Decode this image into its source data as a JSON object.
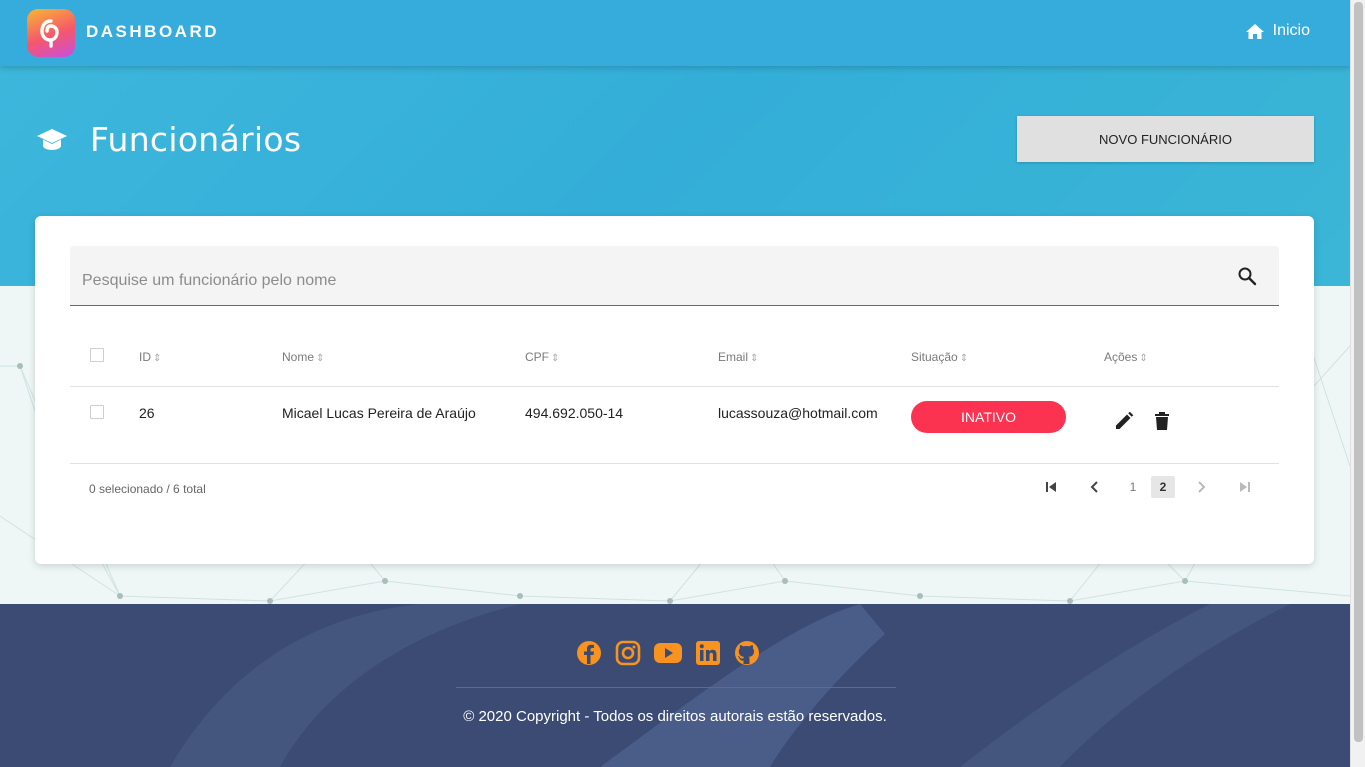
{
  "header": {
    "brand": "DASHBOARD",
    "home_label": "Inicio"
  },
  "page": {
    "title": "Funcionários",
    "new_button": "NOVO FUNCIONÁRIO"
  },
  "search": {
    "placeholder": "Pesquise um funcionário pelo nome",
    "value": ""
  },
  "table": {
    "columns": [
      "ID",
      "Nome",
      "CPF",
      "Email",
      "Situação",
      "Ações"
    ],
    "rows": [
      {
        "id": "26",
        "nome": "Micael Lucas Pereira de Araújo",
        "cpf": "494.692.050-14",
        "email": "lucassouza@hotmail.com",
        "situacao": "INATIVO"
      }
    ]
  },
  "pagination": {
    "summary": "0 selecionado / 6 total",
    "pages": [
      "1",
      "2"
    ],
    "current_page": "2"
  },
  "footer": {
    "social_icons": [
      "facebook-icon",
      "instagram-icon",
      "youtube-icon",
      "linkedin-icon",
      "github-icon"
    ],
    "copyright": "© 2020 Copyright - Todos os direitos autorais estão reservados."
  },
  "colors": {
    "header_blue": "#36acdc",
    "badge_red": "#fb3350",
    "footer_navy": "#3b4b73",
    "social_orange": "#f7931e"
  }
}
